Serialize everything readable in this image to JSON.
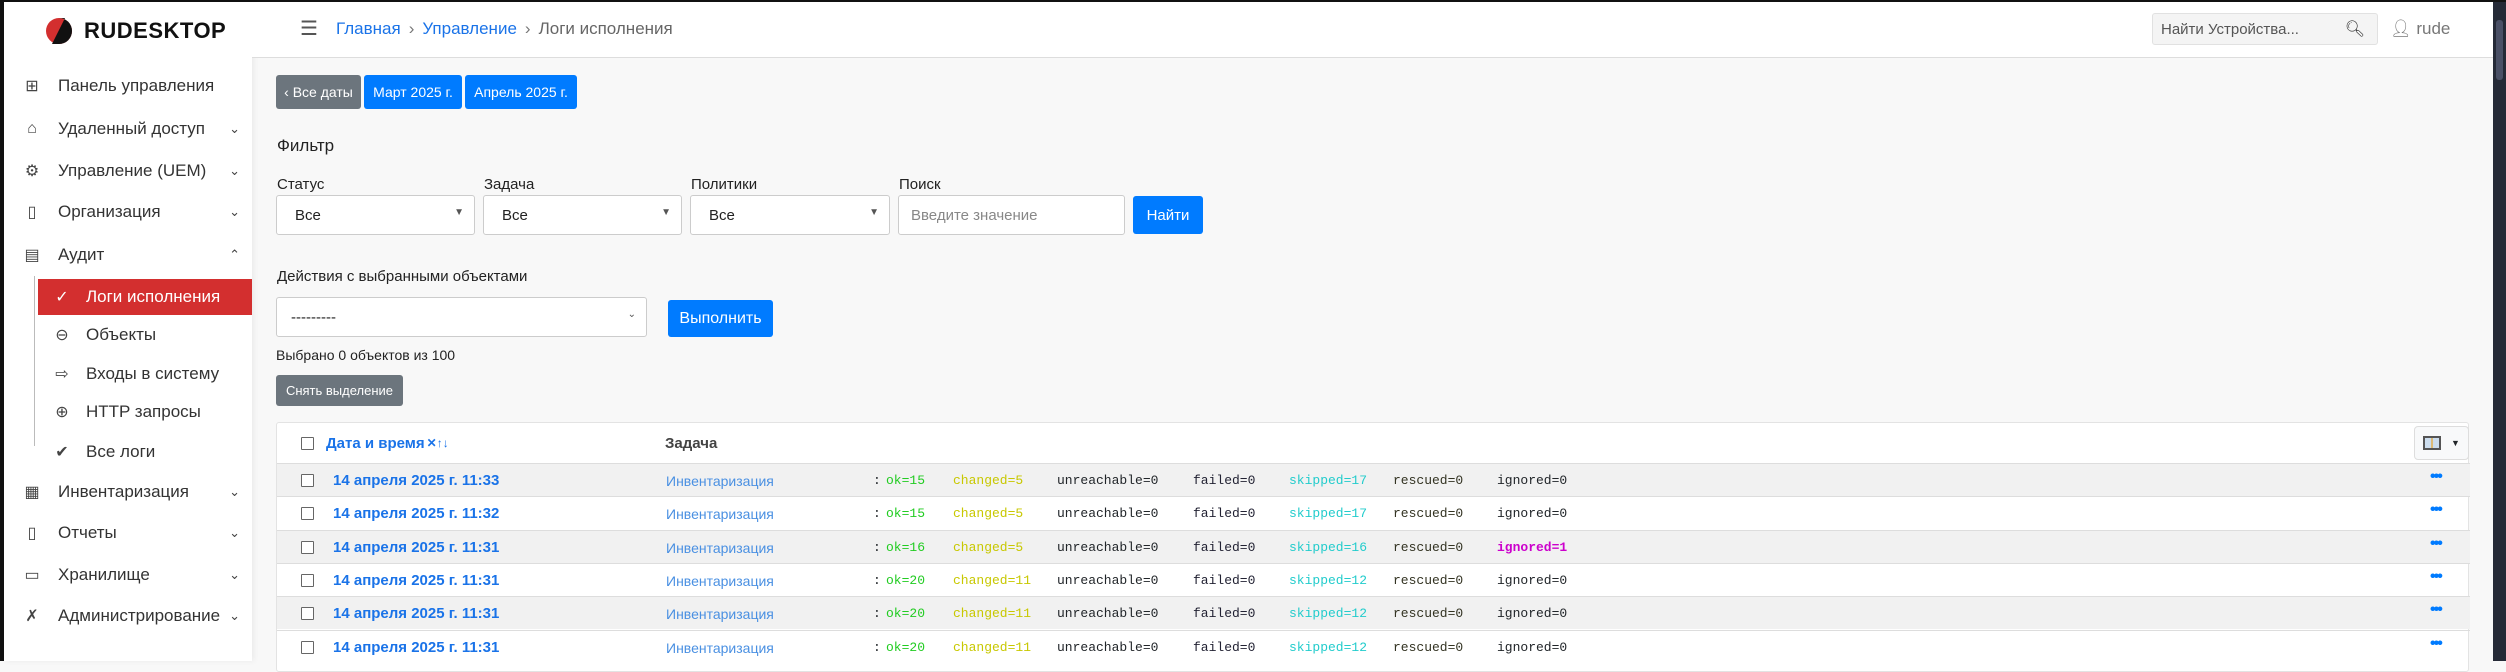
{
  "brand": {
    "name": "RUDESKTOP"
  },
  "sidebar": {
    "items": [
      {
        "label": "Панель управления",
        "icon": "grid-icon",
        "glyph": "⊞"
      },
      {
        "label": "Удаленный доступ",
        "icon": "remote-home-icon",
        "glyph": "⌂",
        "chevron": "⌄"
      },
      {
        "label": "Управление (UEM)",
        "icon": "gears-icon",
        "glyph": "⚙",
        "chevron": "⌄"
      },
      {
        "label": "Организация",
        "icon": "building-icon",
        "glyph": "▯",
        "chevron": "⌄"
      },
      {
        "label": "Аудит",
        "icon": "list-icon",
        "glyph": "▤",
        "chevron": "⌃"
      }
    ],
    "sub_items": [
      {
        "label": "Логи исполнения",
        "icon": "check-circle-icon",
        "glyph": "✓",
        "active": true
      },
      {
        "label": "Объекты",
        "icon": "objects-icon",
        "glyph": "⊖"
      },
      {
        "label": "Входы в систему",
        "icon": "login-icon",
        "glyph": "⇨"
      },
      {
        "label": "HTTP запросы",
        "icon": "globe-icon",
        "glyph": "⊕"
      },
      {
        "label": "Все логи",
        "icon": "double-check-icon",
        "glyph": "✔"
      }
    ],
    "items2": [
      {
        "label": "Инвентаризация",
        "icon": "inventory-icon",
        "glyph": "▦",
        "chevron": "⌄"
      },
      {
        "label": "Отчеты",
        "icon": "report-icon",
        "glyph": "▯",
        "chevron": "⌄"
      },
      {
        "label": "Хранилище",
        "icon": "folder-icon",
        "glyph": "▭",
        "chevron": "⌄"
      },
      {
        "label": "Администрирование",
        "icon": "tools-icon",
        "glyph": "✗",
        "chevron": "⌄"
      }
    ]
  },
  "header": {
    "breadcrumb": [
      "Главная",
      "Управление",
      "Логи исполнения"
    ],
    "search_placeholder": "Найти Устройства...",
    "user": "rude"
  },
  "date_nav": [
    "‹ Все даты",
    "Март 2025 г.",
    "Апрель 2025 г."
  ],
  "filter": {
    "title": "Фильтр",
    "status_label": "Статус",
    "status_value": "Все",
    "task_label": "Задача",
    "task_value": "Все",
    "policy_label": "Политики",
    "policy_value": "Все",
    "search_label": "Поиск",
    "search_placeholder": "Введите значение",
    "find_button": "Найти"
  },
  "actions": {
    "label": "Действия с выбранными объектами",
    "select_value": "---------",
    "run_button": "Выполнить",
    "selected_text": "Выбрано 0 объектов из 100",
    "clear_button": "Снять выделение"
  },
  "table": {
    "columns": [
      "Дата и время",
      "Задача"
    ],
    "sort_glyph": "✕↑↓",
    "rows": [
      {
        "date": "14 апреля 2025 г. 11:33",
        "task": "Инвентаризация",
        "ok": "ok=15",
        "changed": "changed=5",
        "unreachable": "unreachable=0",
        "failed": "failed=0",
        "skipped": "skipped=17",
        "rescued": "rescued=0",
        "ignored": "ignored=0"
      },
      {
        "date": "14 апреля 2025 г. 11:32",
        "task": "Инвентаризация",
        "ok": "ok=15",
        "changed": "changed=5",
        "unreachable": "unreachable=0",
        "failed": "failed=0",
        "skipped": "skipped=17",
        "rescued": "rescued=0",
        "ignored": "ignored=0"
      },
      {
        "date": "14 апреля 2025 г. 11:31",
        "task": "Инвентаризация",
        "ok": "ok=16",
        "changed": "changed=5",
        "unreachable": "unreachable=0",
        "failed": "failed=0",
        "skipped": "skipped=16",
        "rescued": "rescued=0",
        "ignored": "ignored=1",
        "ignored_highlight": true
      },
      {
        "date": "14 апреля 2025 г. 11:31",
        "task": "Инвентаризация",
        "ok": "ok=20",
        "changed": "changed=11",
        "unreachable": "unreachable=0",
        "failed": "failed=0",
        "skipped": "skipped=12",
        "rescued": "rescued=0",
        "ignored": "ignored=0"
      },
      {
        "date": "14 апреля 2025 г. 11:31",
        "task": "Инвентаризация",
        "ok": "ok=20",
        "changed": "changed=11",
        "unreachable": "unreachable=0",
        "failed": "failed=0",
        "skipped": "skipped=12",
        "rescued": "rescued=0",
        "ignored": "ignored=0"
      },
      {
        "date": "14 апреля 2025 г. 11:31",
        "task": "Инвентаризация",
        "ok": "ok=20",
        "changed": "changed=11",
        "unreachable": "unreachable=0",
        "failed": "failed=0",
        "skipped": "skipped=12",
        "rescued": "rescued=0",
        "ignored": "ignored=0"
      }
    ]
  },
  "colors": {
    "accent": "#007bff",
    "active": "#d32f2f",
    "ok": "#22cc22",
    "changed": "#c8c800",
    "skipped": "#22cccc",
    "ignored_highlight": "#cc00cc"
  }
}
